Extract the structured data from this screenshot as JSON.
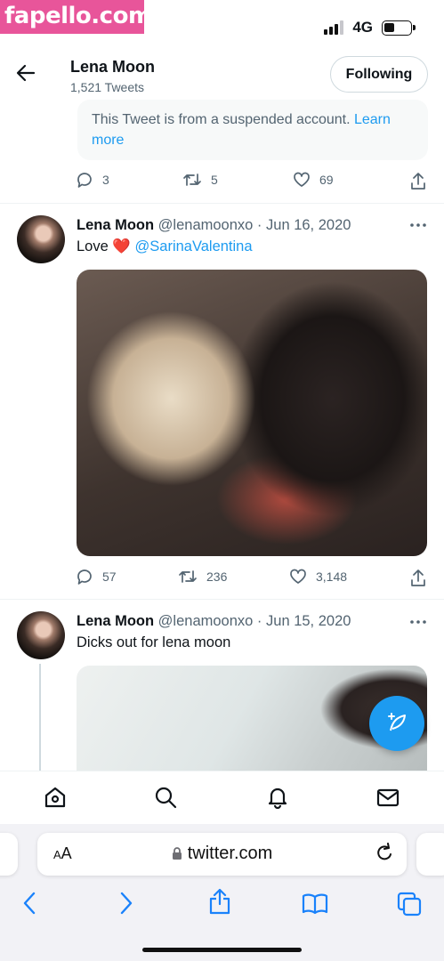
{
  "watermark": "fapello.com",
  "status": {
    "network": "4G"
  },
  "header": {
    "name": "Lena Moon",
    "tweet_count": "1,521 Tweets",
    "follow_button": "Following"
  },
  "suspended_tweet": {
    "text": "This Tweet is from a suspended account.",
    "link": "Learn more",
    "replies": "3",
    "retweets": "5",
    "likes": "69"
  },
  "tweets": [
    {
      "name": "Lena Moon",
      "handle": "@lenamoonxo",
      "separator": "·",
      "date": "Jun 16, 2020",
      "text": "Love",
      "emoji": "❤️",
      "mention": "@SarinaValentina",
      "replies": "57",
      "retweets": "236",
      "likes": "3,148"
    },
    {
      "name": "Lena Moon",
      "handle": "@lenamoonxo",
      "separator": "·",
      "date": "Jun 15, 2020",
      "text": "Dicks out for lena moon"
    }
  ],
  "browser": {
    "text_size_label_small": "A",
    "text_size_label_large": "A",
    "url": "twitter.com"
  },
  "icons": {
    "back": "arrow-left-icon",
    "reply": "reply-icon",
    "retweet": "retweet-icon",
    "like": "heart-icon",
    "share": "share-icon",
    "more": "more-icon",
    "compose": "compose-icon",
    "home": "home-icon",
    "search": "search-icon",
    "notifications": "bell-icon",
    "messages": "mail-icon"
  },
  "colors": {
    "accent": "#1d9bf0",
    "muted": "#536471",
    "watermark": "#e8559a"
  }
}
